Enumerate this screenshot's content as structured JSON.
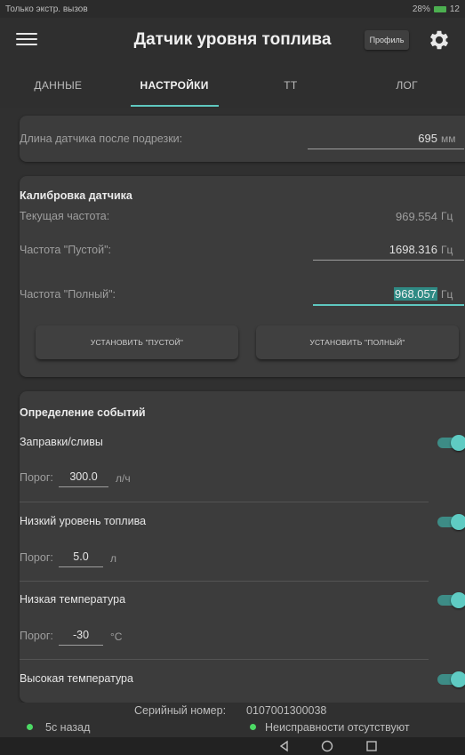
{
  "statusbar": {
    "left_text": "Только экстр. вызов",
    "right_text": "28%",
    "time": "12"
  },
  "appbar": {
    "title": "Датчик уровня топлива",
    "profile_label": "Профиль"
  },
  "tabs": [
    {
      "label": "ДАННЫЕ"
    },
    {
      "label": "НАСТРОЙКИ"
    },
    {
      "label": "ТТ"
    },
    {
      "label": "ЛОГ"
    }
  ],
  "trim": {
    "label": "Длина датчика после подрезки:",
    "value": "695",
    "unit": "мм"
  },
  "calibration": {
    "title": "Калибровка датчика",
    "current_label": "Текущая частота:",
    "current_value": "969.554",
    "current_unit": "Гц",
    "empty_label": "Частота \"Пустой\":",
    "empty_value": "1698.316",
    "empty_unit": "Гц",
    "full_label": "Частота \"Полный\":",
    "full_value": "968.057",
    "full_unit": "Гц",
    "set_empty_button": "УСТАНОВИТЬ \"ПУСТОЙ\"",
    "set_full_button": "УСТАНОВИТЬ \"ПОЛНЫЙ\""
  },
  "events": {
    "title": "Определение событий",
    "threshold_label": "Порог:",
    "items": [
      {
        "label": "Заправки/сливы",
        "threshold": "300.0",
        "unit": "л/ч",
        "enabled": true
      },
      {
        "label": "Низкий уровень топлива",
        "threshold": "5.0",
        "unit": "л",
        "enabled": true
      },
      {
        "label": "Низкая температура",
        "threshold": "-30",
        "unit": "°C",
        "enabled": true
      },
      {
        "label": "Высокая температура",
        "enabled": true
      }
    ]
  },
  "footer": {
    "serial_label": "Серийный номер:",
    "serial_value": "0107001300038",
    "last_update": "5с назад",
    "status": "Неисправности отсутствуют",
    "status_color": "#4cd964"
  },
  "colors": {
    "accent": "#5fc8c0",
    "background": "#303030",
    "card": "#3c3c3c"
  }
}
